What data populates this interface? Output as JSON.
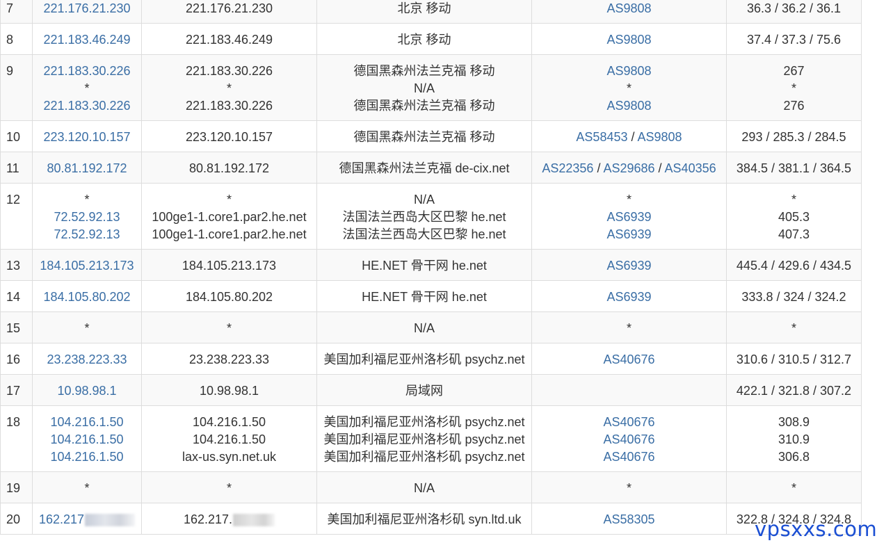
{
  "rows": [
    {
      "hop": "7",
      "ip": [
        "221.176.21.230"
      ],
      "host": [
        "221.176.21.230"
      ],
      "loc": [
        "北京 移动"
      ],
      "asn": [
        [
          "AS9808"
        ]
      ],
      "ms": [
        "36.3 / 36.2 / 36.1"
      ]
    },
    {
      "hop": "8",
      "ip": [
        "221.183.46.249"
      ],
      "host": [
        "221.183.46.249"
      ],
      "loc": [
        "北京 移动"
      ],
      "asn": [
        [
          "AS9808"
        ]
      ],
      "ms": [
        "37.4 / 37.3 / 75.6"
      ]
    },
    {
      "hop": "9",
      "ip": [
        "221.183.30.226",
        "*",
        "221.183.30.226"
      ],
      "host": [
        "221.183.30.226",
        "*",
        "221.183.30.226"
      ],
      "loc": [
        "德国黑森州法兰克福 移动",
        "N/A",
        "德国黑森州法兰克福 移动"
      ],
      "asn": [
        [
          "AS9808"
        ],
        [
          "*"
        ],
        [
          "AS9808"
        ]
      ],
      "ms": [
        "267",
        "*",
        "276"
      ]
    },
    {
      "hop": "10",
      "ip": [
        "223.120.10.157"
      ],
      "host": [
        "223.120.10.157"
      ],
      "loc": [
        "德国黑森州法兰克福 移动"
      ],
      "asn": [
        [
          "AS58453",
          "AS9808"
        ]
      ],
      "ms": [
        "293 / 285.3 / 284.5"
      ]
    },
    {
      "hop": "11",
      "ip": [
        "80.81.192.172"
      ],
      "host": [
        "80.81.192.172"
      ],
      "loc": [
        "德国黑森州法兰克福 de-cix.net"
      ],
      "asn": [
        [
          "AS22356",
          "AS29686",
          "AS40356"
        ]
      ],
      "ms": [
        "384.5 / 381.1 / 364.5"
      ]
    },
    {
      "hop": "12",
      "ip": [
        "*",
        "72.52.92.13",
        "72.52.92.13"
      ],
      "host": [
        "*",
        "100ge1-1.core1.par2.he.net",
        "100ge1-1.core1.par2.he.net"
      ],
      "loc": [
        "N/A",
        "法国法兰西岛大区巴黎 he.net",
        "法国法兰西岛大区巴黎 he.net"
      ],
      "asn": [
        [
          "*"
        ],
        [
          "AS6939"
        ],
        [
          "AS6939"
        ]
      ],
      "ms": [
        "*",
        "405.3",
        "407.3"
      ]
    },
    {
      "hop": "13",
      "ip": [
        "184.105.213.173"
      ],
      "host": [
        "184.105.213.173"
      ],
      "loc": [
        "HE.NET 骨干网 he.net"
      ],
      "asn": [
        [
          "AS6939"
        ]
      ],
      "ms": [
        "445.4 / 429.6 / 434.5"
      ]
    },
    {
      "hop": "14",
      "ip": [
        "184.105.80.202"
      ],
      "host": [
        "184.105.80.202"
      ],
      "loc": [
        "HE.NET 骨干网 he.net"
      ],
      "asn": [
        [
          "AS6939"
        ]
      ],
      "ms": [
        "333.8 / 324 / 324.2"
      ]
    },
    {
      "hop": "15",
      "ip": [
        "*"
      ],
      "host": [
        "*"
      ],
      "loc": [
        "N/A"
      ],
      "asn": [
        [
          "*"
        ]
      ],
      "ms": [
        "*"
      ]
    },
    {
      "hop": "16",
      "ip": [
        "23.238.223.33"
      ],
      "host": [
        "23.238.223.33"
      ],
      "loc": [
        "美国加利福尼亚州洛杉矶 psychz.net"
      ],
      "asn": [
        [
          "AS40676"
        ]
      ],
      "ms": [
        "310.6 / 310.5 / 312.7"
      ]
    },
    {
      "hop": "17",
      "ip": [
        "10.98.98.1"
      ],
      "host": [
        "10.98.98.1"
      ],
      "loc": [
        "局域网"
      ],
      "asn": [
        []
      ],
      "ms": [
        "422.1 / 321.8 / 307.2"
      ]
    },
    {
      "hop": "18",
      "ip": [
        "104.216.1.50",
        "104.216.1.50",
        "104.216.1.50"
      ],
      "host": [
        "104.216.1.50",
        "104.216.1.50",
        "lax-us.syn.net.uk"
      ],
      "loc": [
        "美国加利福尼亚州洛杉矶 psychz.net",
        "美国加利福尼亚州洛杉矶 psychz.net",
        "美国加利福尼亚州洛杉矶 psychz.net"
      ],
      "asn": [
        [
          "AS40676"
        ],
        [
          "AS40676"
        ],
        [
          "AS40676"
        ]
      ],
      "ms": [
        "308.9",
        "310.9",
        "306.8"
      ]
    },
    {
      "hop": "19",
      "ip": [
        "*"
      ],
      "host": [
        "*"
      ],
      "loc": [
        "N/A"
      ],
      "asn": [
        [
          "*"
        ]
      ],
      "ms": [
        "*"
      ]
    },
    {
      "hop": "20",
      "ip": [
        "162.217"
      ],
      "host": [
        "162.217."
      ],
      "loc": [
        "美国加利福尼亚州洛杉矶 syn.ltd.uk"
      ],
      "asn": [
        [
          "AS58305"
        ]
      ],
      "ms": [
        "322.8 / 324.8 / 324.8"
      ]
    }
  ],
  "watermark": "vpsxxs.com"
}
